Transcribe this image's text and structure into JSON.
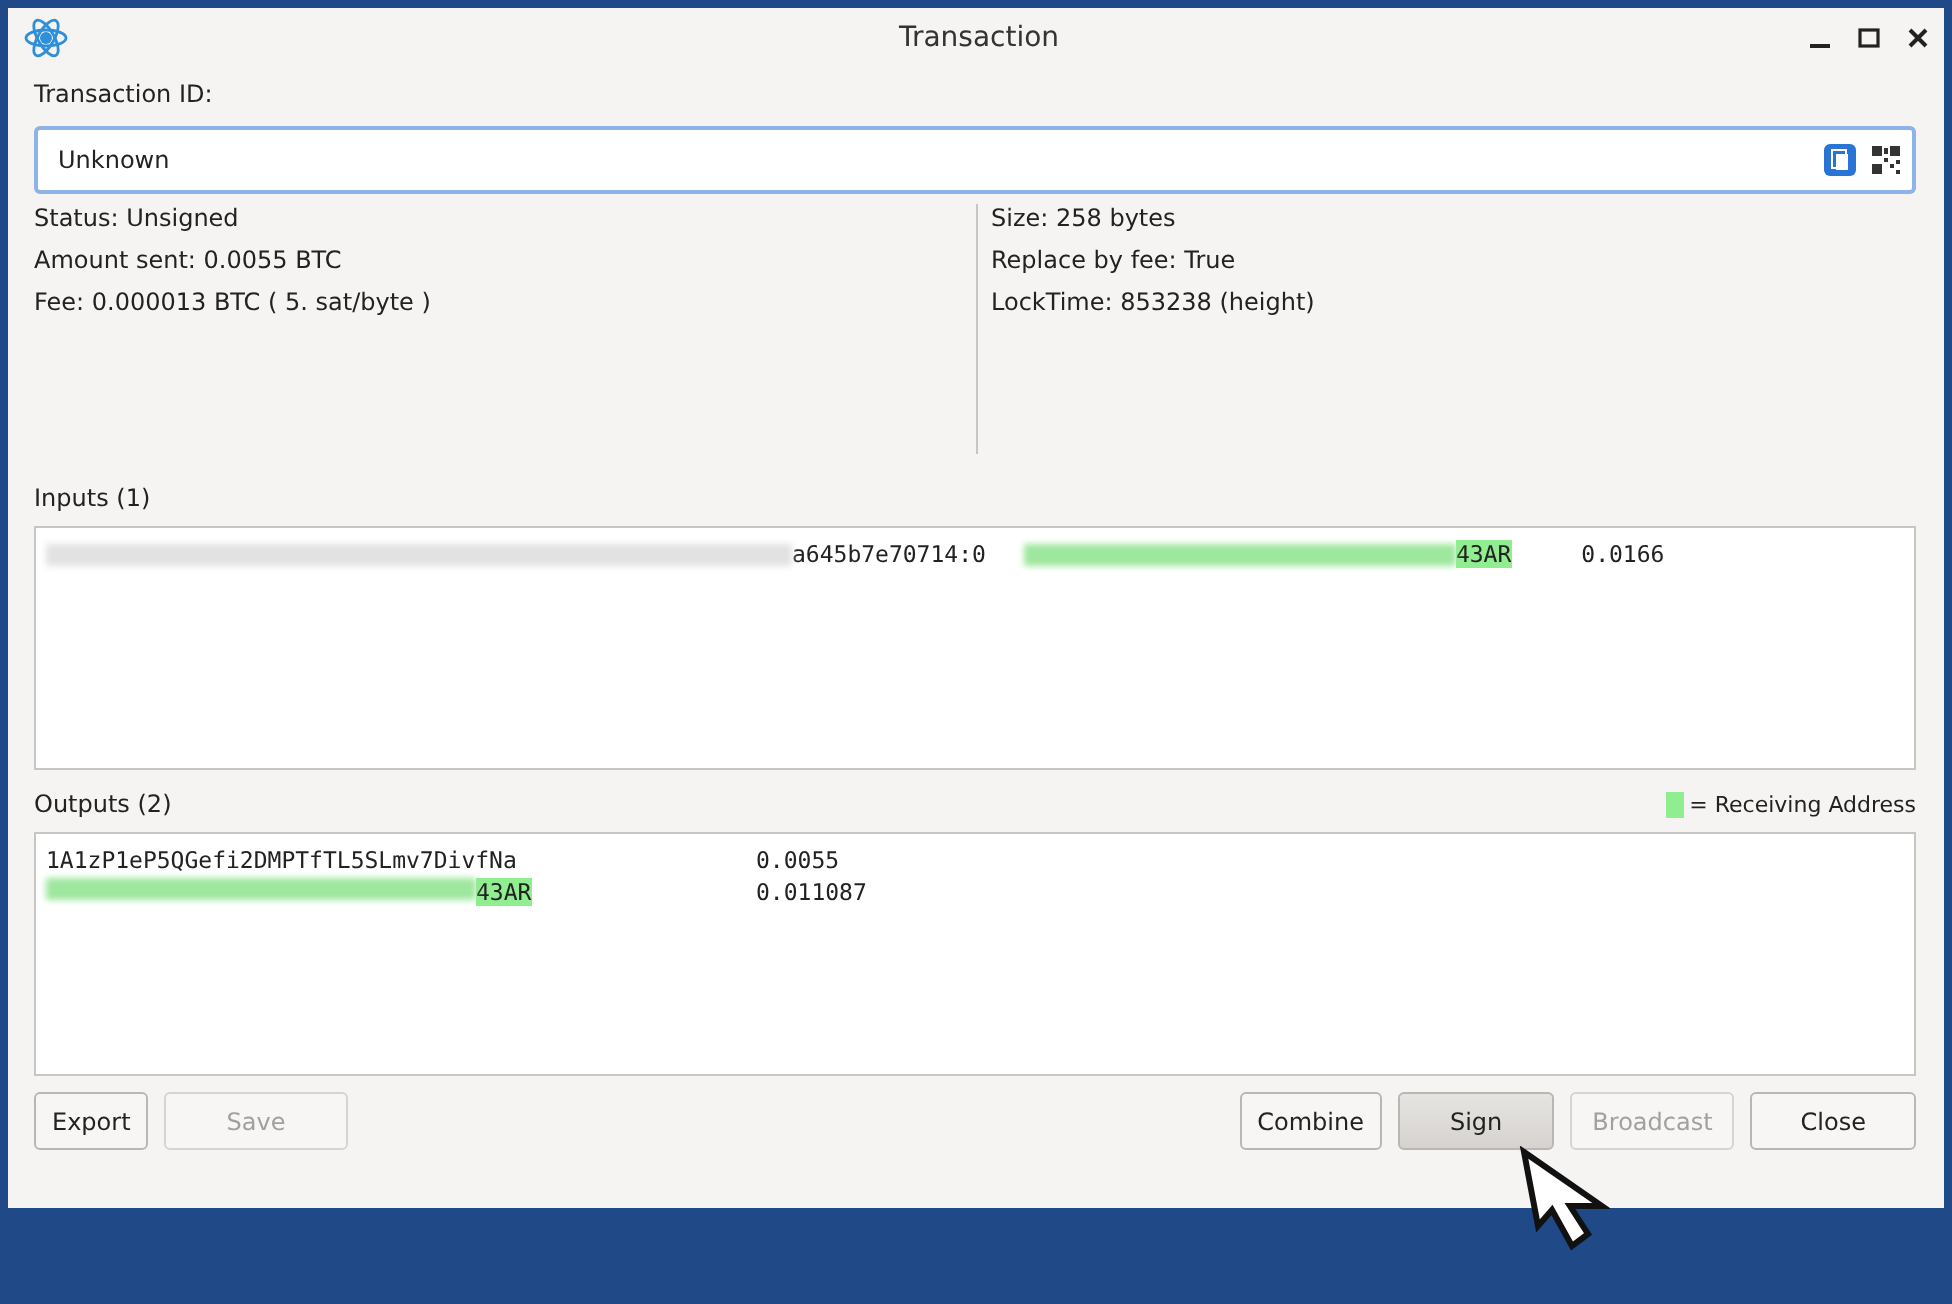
{
  "window": {
    "title": "Transaction"
  },
  "txid": {
    "label": "Transaction ID:",
    "value": "Unknown"
  },
  "info_left": [
    "Status: Unsigned",
    "Amount sent: 0.0055 BTC",
    "Fee: 0.000013 BTC  ( 5. sat/byte )"
  ],
  "info_right": [
    "Size: 258 bytes",
    "Replace by fee: True",
    "LockTime: 853238 (height)"
  ],
  "inputs": {
    "label": "Inputs (1)",
    "rows": [
      {
        "prevout": "a645b7e70714:0",
        "address": "43AR",
        "mine": true,
        "amount": "0.0166"
      }
    ]
  },
  "outputs": {
    "label": "Outputs (2)",
    "legend": "= Receiving Address",
    "rows": [
      {
        "address": "1A1zP1eP5QGefi2DMPTfTL5SLmv7DivfNa",
        "mine": false,
        "redacted": false,
        "amount": "0.0055"
      },
      {
        "address": "43AR",
        "mine": true,
        "redacted": true,
        "amount": "0.011087"
      }
    ]
  },
  "buttons_left": [
    {
      "label": "Export",
      "disabled": false,
      "pressed": false
    },
    {
      "label": "Save",
      "disabled": true,
      "pressed": false
    }
  ],
  "buttons_right": [
    {
      "label": "Combine",
      "disabled": false,
      "pressed": false
    },
    {
      "label": "Sign",
      "disabled": false,
      "pressed": true
    },
    {
      "label": "Broadcast",
      "disabled": true,
      "pressed": false
    },
    {
      "label": "Close",
      "disabled": false,
      "pressed": false
    }
  ]
}
